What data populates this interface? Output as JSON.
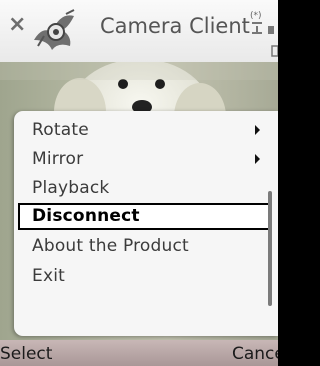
{
  "titlebar": {
    "title": "Camera Client",
    "close_icon": "×"
  },
  "menu": {
    "items": [
      {
        "label": "Rotate",
        "submenu": true
      },
      {
        "label": "Mirror",
        "submenu": true
      },
      {
        "label": "Playback",
        "submenu": false
      },
      {
        "label": "Disconnect",
        "submenu": false,
        "selected": true
      },
      {
        "label": "About the Product",
        "submenu": false
      },
      {
        "label": "Exit",
        "submenu": false
      }
    ]
  },
  "softkeys": {
    "left": "Select",
    "right": "Cance"
  },
  "icons": [
    "close-icon",
    "app-logo-icon",
    "signal-status-icon",
    "submenu-arrow-icon"
  ]
}
